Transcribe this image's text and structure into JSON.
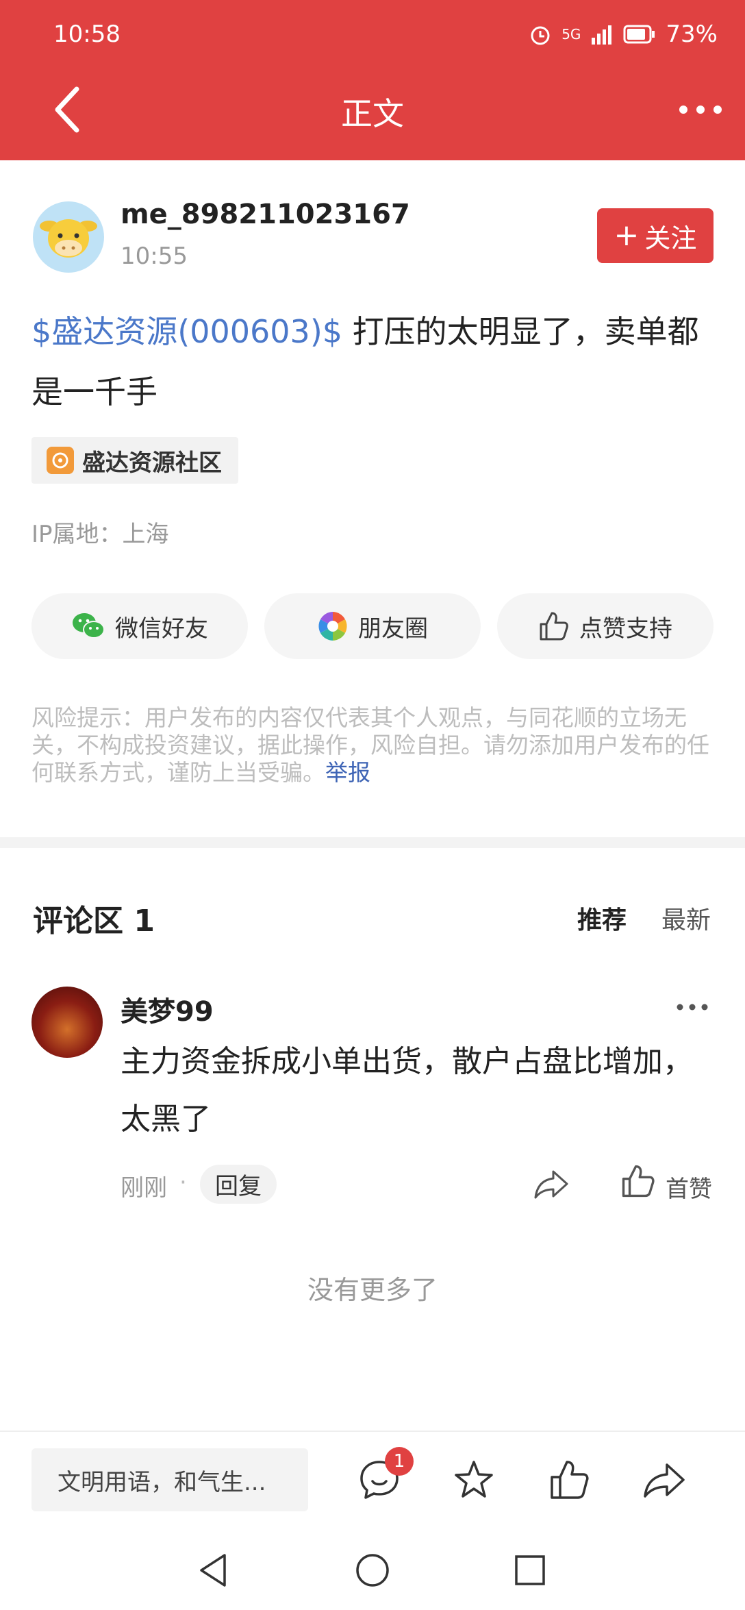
{
  "status_bar": {
    "time": "10:58",
    "network": "5G",
    "battery": "73%"
  },
  "nav": {
    "title": "正文"
  },
  "post": {
    "username": "me_898211023167",
    "time": "10:55",
    "follow_label": "关注",
    "stock_link": "$盛达资源(000603)$",
    "text": " 打压的太明显了，卖单都是一千手",
    "community": "盛达资源社区",
    "ip_location": "IP属地：上海",
    "share": [
      {
        "label": "微信好友",
        "icon": "wechat-icon"
      },
      {
        "label": "朋友圈",
        "icon": "moments-icon"
      },
      {
        "label": "点赞支持",
        "icon": "thumbs-up-icon"
      }
    ],
    "risk_notice": "风险提示：用户发布的内容仅代表其个人观点，与同花顺的立场无关，不构成投资建议，据此操作，风险自担。请勿添加用户发布的任何联系方式，谨防上当受骗。",
    "report_label": "举报"
  },
  "comments": {
    "title": "评论区 1",
    "sort_recommended": "推荐",
    "sort_latest": "最新",
    "items": [
      {
        "username": "美梦99",
        "text": "主力资金拆成小单出货，散户占盘比增加，太黑了",
        "time": "刚刚",
        "separator": "·",
        "reply_label": "回复",
        "like_label": "首赞"
      }
    ],
    "no_more": "没有更多了"
  },
  "bottom_bar": {
    "input_placeholder": "文明用语，和气生...",
    "comment_badge": "1"
  },
  "colors": {
    "brand_red": "#e04141",
    "link_blue": "#4b78c9"
  }
}
